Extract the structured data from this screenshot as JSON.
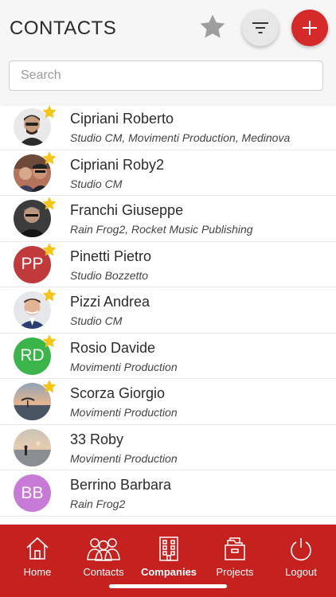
{
  "header": {
    "title": "CONTACTS",
    "search_placeholder": "Search"
  },
  "colors": {
    "accent": "#d42a2a",
    "nav_bg": "#c4211f",
    "favorite_star": "#f5c518",
    "star_button": "#9e9e9e"
  },
  "contacts": [
    {
      "name": "Cipriani Roberto",
      "company": "Studio CM, Movimenti Production, Medinova",
      "favorite": true,
      "avatar": "photo"
    },
    {
      "name": "Cipriani Roby2",
      "company": "Studio CM",
      "favorite": true,
      "avatar": "photo"
    },
    {
      "name": "Franchi Giuseppe",
      "company": "Rain Frog2, Rocket Music Publishing",
      "favorite": true,
      "avatar": "photo"
    },
    {
      "name": "Pinetti Pietro",
      "company": "Studio Bozzetto",
      "favorite": true,
      "avatar": "initials",
      "initials": "PP",
      "color": "#c0393b"
    },
    {
      "name": "Pizzi Andrea",
      "company": "Studio CM",
      "favorite": true,
      "avatar": "photo"
    },
    {
      "name": "Rosio Davide",
      "company": "Movimenti Production",
      "favorite": true,
      "avatar": "initials",
      "initials": "RD",
      "color": "#3bb54a"
    },
    {
      "name": "Scorza Giorgio",
      "company": "Movimenti Production",
      "favorite": true,
      "avatar": "photo"
    },
    {
      "name": "33 Roby",
      "company": "Movimenti Production",
      "favorite": false,
      "avatar": "photo"
    },
    {
      "name": "Berrino Barbara",
      "company": "Rain Frog2",
      "favorite": false,
      "avatar": "initials",
      "initials": "BB",
      "color": "#c77ad6"
    }
  ],
  "nav": [
    {
      "label": "Home",
      "icon": "home-icon",
      "active": false
    },
    {
      "label": "Contacts",
      "icon": "contacts-icon",
      "active": false
    },
    {
      "label": "Companies",
      "icon": "companies-icon",
      "active": true
    },
    {
      "label": "Projects",
      "icon": "projects-icon",
      "active": false
    },
    {
      "label": "Logout",
      "icon": "logout-icon",
      "active": false
    }
  ]
}
